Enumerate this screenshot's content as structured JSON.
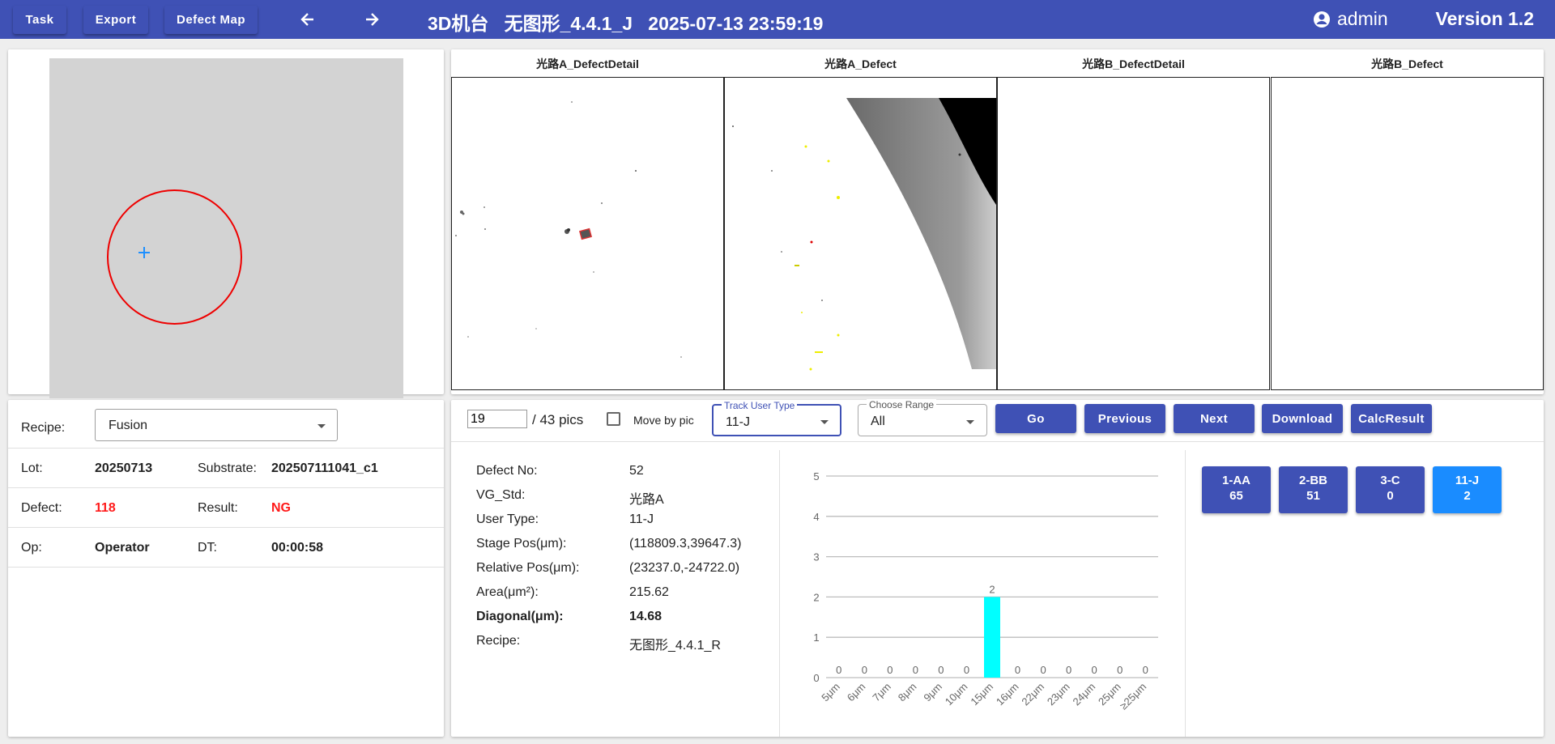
{
  "toolbar": {
    "task_label": "Task",
    "export_label": "Export",
    "defect_map_label": "Defect Map",
    "title": "3D机台   无图形_4.4.1_J   2025-07-13 23:59:19",
    "user": "admin",
    "version": "Version 1.2"
  },
  "info": {
    "recipe_label": "Recipe:",
    "recipe_value": "Fusion",
    "lot_label": "Lot:",
    "lot_value": "20250713",
    "substrate_label": "Substrate:",
    "substrate_value": "202507111041_c1",
    "defect_label": "Defect:",
    "defect_value": "118",
    "result_label": "Result:",
    "result_value": "NG",
    "op_label": "Op:",
    "op_value": "Operator",
    "dt_label": "DT:",
    "dt_value": "00:00:58"
  },
  "images": [
    {
      "title": "光路A_DefectDetail"
    },
    {
      "title": "光路A_Defect"
    },
    {
      "title": "光路B_DefectDetail"
    },
    {
      "title": "光路B_Defect"
    }
  ],
  "controls": {
    "pic_index": "19",
    "pic_total": "/ 43 pics",
    "move_by_pic_label": "Move by pic",
    "track_user_type_label": "Track User Type",
    "track_user_type_value": "11-J",
    "choose_range_label": "Choose Range",
    "choose_range_value": "All",
    "go_label": "Go",
    "previous_label": "Previous",
    "next_label": "Next",
    "download_label": "Download",
    "calc_label": "CalcResult"
  },
  "detail": [
    {
      "label": "Defect No:",
      "value": "52",
      "bold": false
    },
    {
      "label": "VG_Std:",
      "value": "光路A",
      "bold": false
    },
    {
      "label": "User Type:",
      "value": "11-J",
      "bold": false
    },
    {
      "label": "Stage Pos(μm):",
      "value": "(118809.3,39647.3)",
      "bold": false
    },
    {
      "label": "Relative Pos(μm):",
      "value": "(23237.0,-24722.0)",
      "bold": false
    },
    {
      "label": "Area(μm²):",
      "value": "215.62",
      "bold": false
    },
    {
      "label": "Diagonal(μm):",
      "value": "14.68",
      "bold": true
    },
    {
      "label": "Recipe:",
      "value": "无图形_4.4.1_R",
      "bold": false
    }
  ],
  "chart_data": {
    "type": "bar",
    "categories": [
      "5μm",
      "6μm",
      "7μm",
      "8μm",
      "9μm",
      "10μm",
      "15μm",
      "16μm",
      "22μm",
      "23μm",
      "24μm",
      "25μm",
      "≥25μm"
    ],
    "values": [
      0,
      0,
      0,
      0,
      0,
      0,
      2,
      0,
      0,
      0,
      0,
      0,
      0
    ],
    "ylim": [
      0,
      5
    ],
    "yticks": [
      0,
      1,
      2,
      3,
      4,
      5
    ],
    "bar_color": "#00ffff",
    "grid": true
  },
  "type_buttons": [
    {
      "name": "1-AA",
      "count": "65",
      "active": false
    },
    {
      "name": "2-BB",
      "count": "51",
      "active": false
    },
    {
      "name": "3-C",
      "count": "0",
      "active": false
    },
    {
      "name": "11-J",
      "count": "2",
      "active": true
    }
  ],
  "colors": {
    "primary": "#3f51b5",
    "active": "#1a8cff",
    "alert": "#ff1a1a"
  }
}
